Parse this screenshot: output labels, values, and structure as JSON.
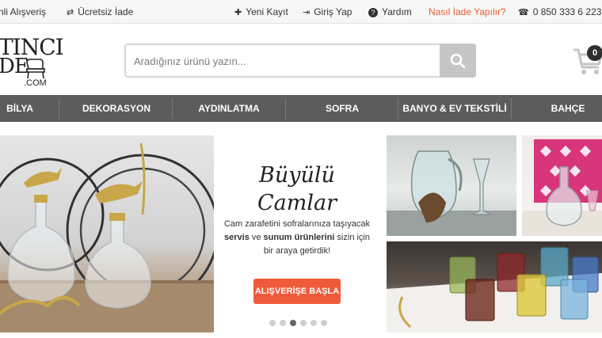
{
  "topbar": {
    "left_items": [
      {
        "label": "nli Alışveriş",
        "icon": "none"
      },
      {
        "label": "Ücretsiz İade",
        "icon": "exchange-icon"
      }
    ],
    "right_items": [
      {
        "label": "Yeni Kayıt",
        "icon": "plus-icon"
      },
      {
        "label": "Giriş Yap",
        "icon": "login-icon"
      },
      {
        "label": "Yardım",
        "icon": "help-icon"
      },
      {
        "label": "Nasıl İade Yapılır?",
        "icon": "none",
        "color": "#e85b36"
      },
      {
        "label": "0 850 333 6 223",
        "icon": "phone-icon"
      }
    ]
  },
  "logo": {
    "line1": "TINCI",
    "line2": "DE",
    "line3": ".COM"
  },
  "search": {
    "placeholder": "Aradığınız ürünü yazın...",
    "value": "",
    "button_icon": "search-icon"
  },
  "cart": {
    "icon": "cart-icon",
    "count": "0"
  },
  "nav": {
    "categories": [
      "BİLYA",
      "DEKORASYON",
      "AYDINLATMA",
      "SOFRA",
      "BANYO & EV TEKSTİLİ",
      "BAHÇE"
    ],
    "background": "#5c5c5c"
  },
  "promo": {
    "title_line1": "Büyülü",
    "title_line2": "Camlar",
    "desc_part1": "Cam zarafetini sofralarınıza taşıyacak",
    "desc_bold1": "servis",
    "desc_part2": " ve ",
    "desc_bold2": "sunum ürünlerini",
    "desc_part3": " sizin için bir araya getirdik!",
    "cta_label": "ALIŞVERİŞE BAŞLA",
    "cta_color": "#ee5a3a",
    "slide_count": 6,
    "active_slide": 3
  },
  "colors": {
    "accent": "#ee5a3a",
    "nav_bg": "#5c5c5c",
    "topbar_bg": "#f7f7f7"
  }
}
